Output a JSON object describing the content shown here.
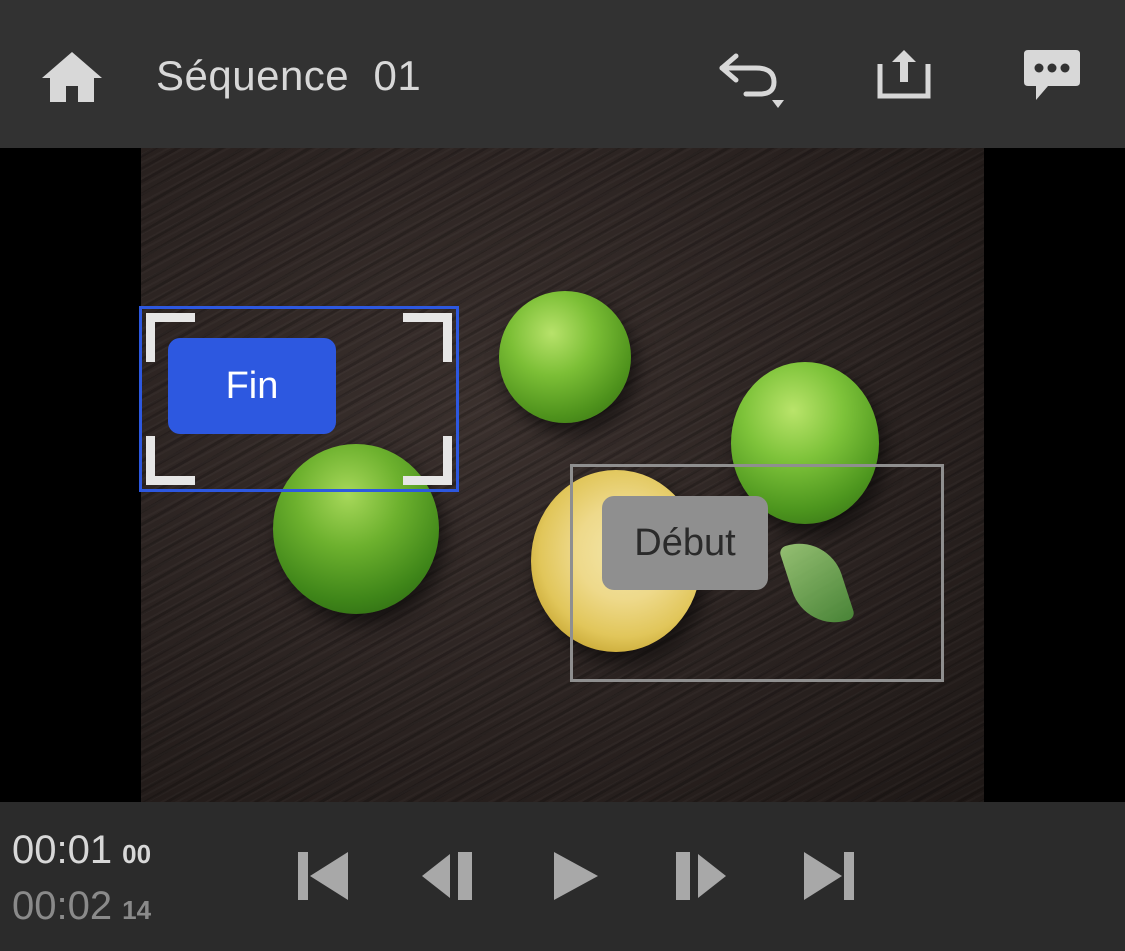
{
  "header": {
    "title": "Séquence  01",
    "icons": {
      "home": "home-icon",
      "undo": "undo-icon",
      "share": "share-icon",
      "comment": "comment-icon"
    }
  },
  "viewer": {
    "markers": {
      "end_label": "Fin",
      "start_label": "Début"
    },
    "colors": {
      "end_marker": "#2d58e0",
      "start_marker": "#8f8f8f"
    }
  },
  "playback": {
    "current_time": "00:01",
    "current_frames": "00",
    "total_time": "00:02",
    "total_frames": "14",
    "controls": [
      "skip-to-start-icon",
      "step-back-icon",
      "play-icon",
      "step-forward-icon",
      "skip-to-end-icon"
    ]
  }
}
